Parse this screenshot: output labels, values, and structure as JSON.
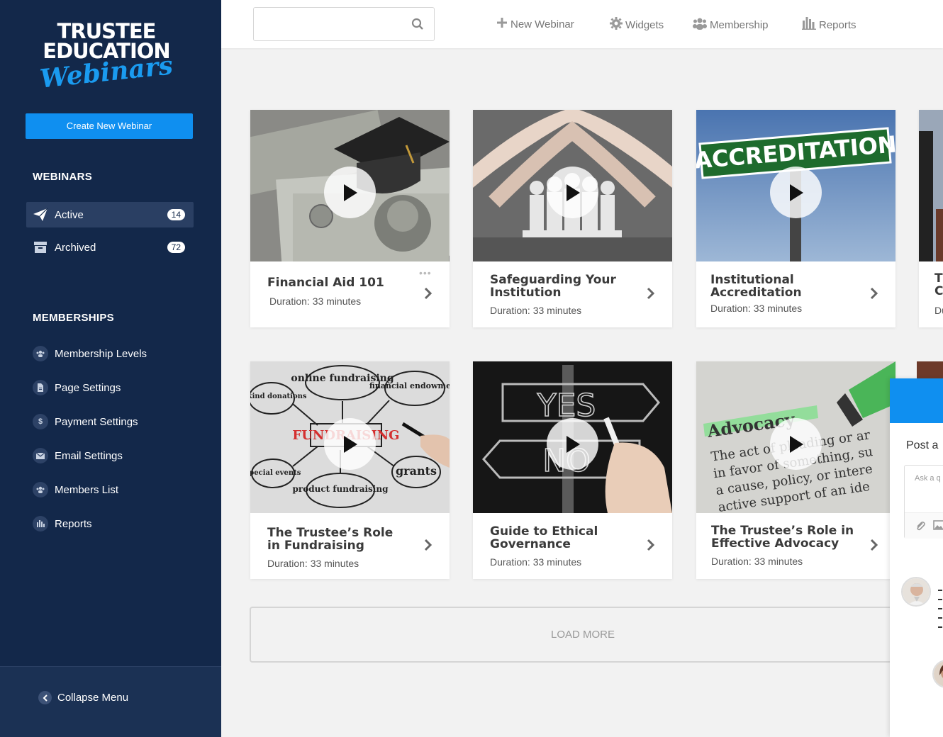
{
  "brand": {
    "line1": "TRUSTEE",
    "line2": "EDUCATION",
    "line3": "Webinars",
    "accent_color": "#1a9bf0"
  },
  "sidebar": {
    "create_button": "Create New Webinar",
    "webinars_title": "WEBINARS",
    "webinar_items": [
      {
        "label": "Active",
        "count": "14",
        "icon": "paper-plane-icon"
      },
      {
        "label": "Archived",
        "count": "72",
        "icon": "archive-box-icon"
      }
    ],
    "memberships_title": "MEMBERSHIPS",
    "membership_items": [
      {
        "label": "Membership Levels",
        "icon": "users-icon"
      },
      {
        "label": "Page Settings",
        "icon": "document-icon"
      },
      {
        "label": "Payment Settings",
        "icon": "dollar-icon"
      },
      {
        "label": "Email Settings",
        "icon": "envelope-icon"
      },
      {
        "label": "Members List",
        "icon": "users-icon"
      },
      {
        "label": "Reports",
        "icon": "bar-chart-icon"
      }
    ],
    "collapse_label": "Collapse Menu",
    "bg_color": "#13284a"
  },
  "topbar": {
    "search_placeholder": "",
    "nav": [
      {
        "label": "New Webinar",
        "icon": "plus-icon"
      },
      {
        "label": "Widgets",
        "icon": "gear-icon"
      },
      {
        "label": "Membership",
        "icon": "users-icon"
      },
      {
        "label": "Reports",
        "icon": "bar-chart-icon"
      }
    ]
  },
  "webinars": [
    {
      "title": "Financial Aid 101",
      "duration": "Duration: 33 minutes"
    },
    {
      "title": "Safeguarding Your Institution",
      "duration": "Duration: 33 minutes"
    },
    {
      "title": "Institutional Accreditation",
      "duration": "Duration: 33 minutes",
      "sign_text": "ACCREDITATION"
    },
    {
      "title": "The Trustee’s Role in Fundraising",
      "duration": "Duration: 33 minutes",
      "words": [
        "online fundraising",
        "in-kind donations",
        "financial endowment",
        "FUNDRAISING",
        "special events",
        "product fundraising",
        "grants"
      ]
    },
    {
      "title": "Guide to Ethical Governance",
      "duration": "Duration: 33 minutes",
      "sign_words": [
        "YES",
        "NO"
      ]
    },
    {
      "title": "The Trustee’s Role in Effective Advocacy",
      "duration": "Duration: 33 minutes",
      "sign_text": "Advocacy",
      "body_lines": [
        "The act of pleading or ar",
        "in favor of something, su",
        "a cause, policy, or intere",
        "active support of an ide"
      ]
    }
  ],
  "partial_card": {
    "title_chars": "Th C",
    "dur_chars": "Du"
  },
  "load_more": "LOAD MORE",
  "chat": {
    "post_label": "Post a",
    "ask_placeholder": "Ask a q"
  }
}
